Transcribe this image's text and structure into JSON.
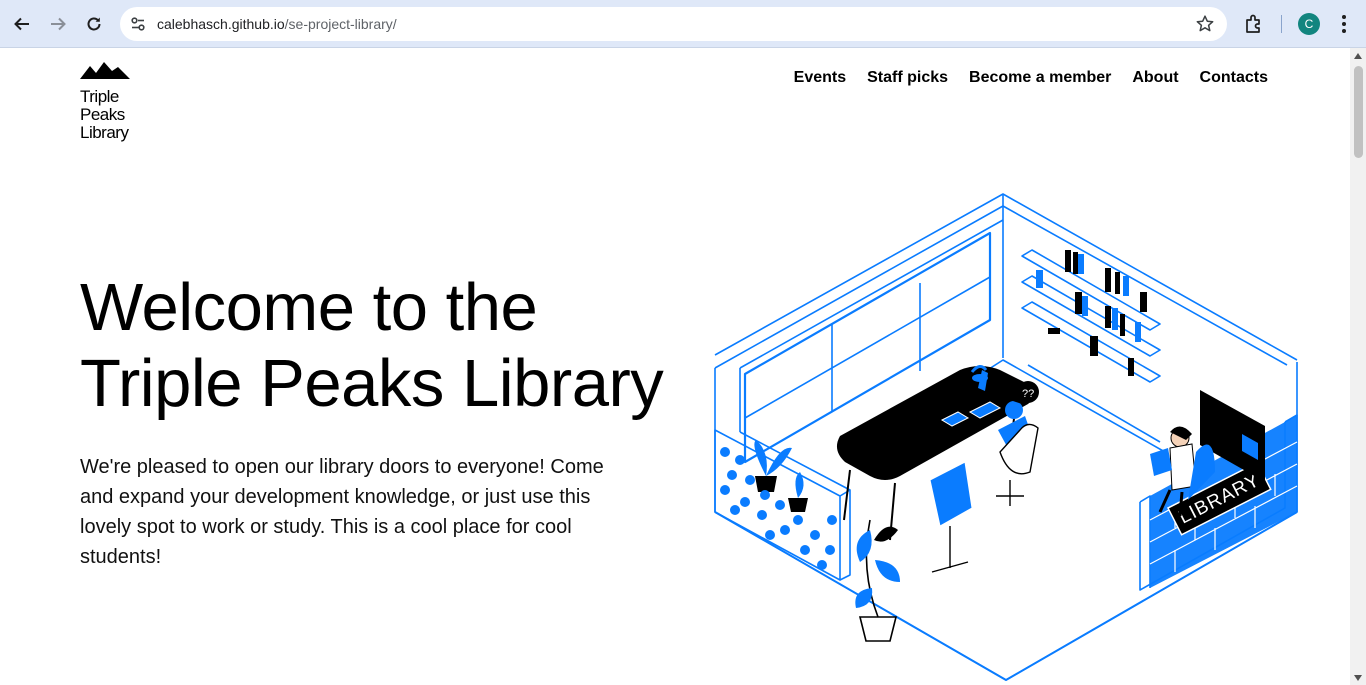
{
  "browser": {
    "url_host": "calebhasch.github.io",
    "url_path": "/se-project-library/",
    "avatar_letter": "C",
    "colors": {
      "toolbar": "#dfe8f8",
      "avatar": "#12857f"
    }
  },
  "site": {
    "logo_lines": [
      "Triple",
      "Peaks",
      "Library"
    ],
    "nav": [
      "Events",
      "Staff picks",
      "Become a member",
      "About",
      "Contacts"
    ]
  },
  "hero": {
    "title_lines": [
      "Welcome to the",
      "Triple Peaks Library"
    ],
    "text": "We're pleased to open our library doors to everyone! Come and expand your development knowledge, or just use this lovely spot to work or study. This is a cool place for cool students!",
    "sign_text": "LIBRARY",
    "accent_color": "#0a7cff"
  }
}
